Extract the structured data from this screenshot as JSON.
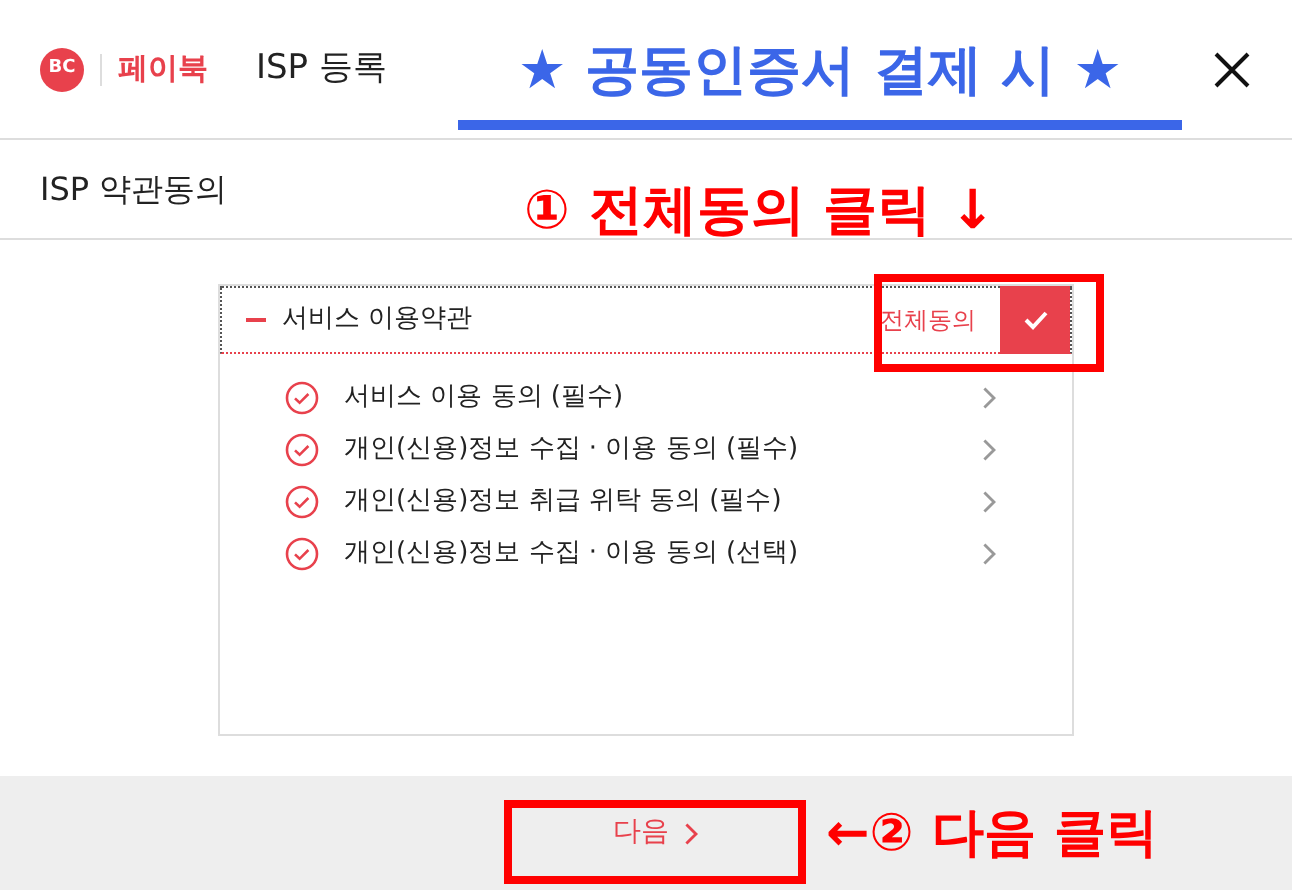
{
  "header": {
    "logo_mark": "BC",
    "logo_text": "페이북",
    "title": "ISP 등록"
  },
  "section_title": "ISP 약관동의",
  "terms": {
    "title": "서비스 이용약관",
    "expanded": true,
    "agree_all": {
      "label": "전체동의",
      "checked": true
    },
    "items": [
      {
        "label": "서비스 이용 동의 (필수)",
        "checked": true
      },
      {
        "label": "개인(신용)정보 수집 · 이용 동의 (필수)",
        "checked": true
      },
      {
        "label": "개인(신용)정보 취급 위탁 동의 (필수)",
        "checked": true
      },
      {
        "label": "개인(신용)정보 수집 · 이용 동의 (선택)",
        "checked": true
      }
    ]
  },
  "next_button": {
    "label": "다음"
  },
  "annotations": {
    "banner": "★ 공동인증서 결제 시 ★",
    "step_1": "① 전체동의 클릭 ↓",
    "step_2": "←② 다음 클릭"
  }
}
